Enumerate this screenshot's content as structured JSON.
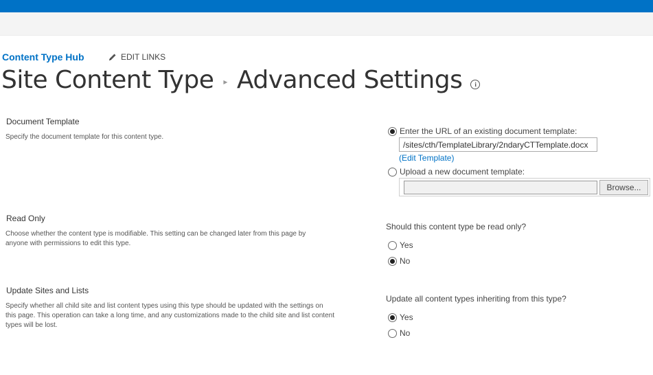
{
  "header": {
    "site_name": "Content Type Hub",
    "edit_links_label": "EDIT LINKS",
    "title_part1": "Site Content Type",
    "title_separator": "▸",
    "title_part2": "Advanced Settings",
    "info_glyph": "i"
  },
  "sections": {
    "document_template": {
      "title": "Document Template",
      "description": "Specify the document template for this content type.",
      "option_existing_label": "Enter the URL of an existing document template:",
      "url_value": "/sites/cth/TemplateLibrary/2ndaryCTTemplate.docx",
      "edit_template_link": "(Edit Template)",
      "option_upload_label": "Upload a new document template:",
      "browse_label": "Browse...",
      "selected": "existing"
    },
    "read_only": {
      "title": "Read Only",
      "description": "Choose whether the content type is modifiable. This setting can be changed later from this page by anyone with permissions to edit this type.",
      "question": "Should this content type be read only?",
      "yes_label": "Yes",
      "no_label": "No",
      "selected": "No"
    },
    "update_sites": {
      "title": "Update Sites and Lists",
      "description": "Specify whether all child site and list content types using this type should be updated with the settings on this page. This operation can take a long time, and any customizations made to the child site and list content types will be lost.",
      "question": "Update all content types inheriting from this type?",
      "yes_label": "Yes",
      "no_label": "No",
      "selected": "Yes"
    }
  },
  "colors": {
    "suite_bar": "#0072c6",
    "link": "#0072c6"
  }
}
